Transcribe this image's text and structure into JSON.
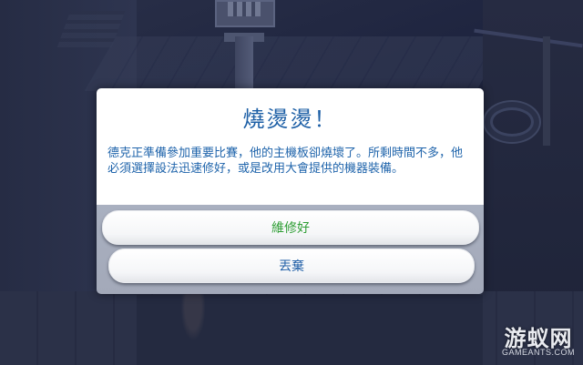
{
  "dialog": {
    "title": "燒燙燙！",
    "message": "德克正準備參加重要比賽，他的主機板卻燒壞了。所剩時間不多，他必須選擇設法迅速修好，或是改用大會提供的機器裝備。",
    "options": [
      {
        "label": "維修好",
        "color": "#2f9e35"
      },
      {
        "label": "丟棄",
        "color": "#1f5ea6"
      }
    ]
  },
  "watermark": {
    "logo": "游蚁网",
    "url": "GAMEANTS.COM"
  },
  "colors": {
    "title": "#1d5fa6",
    "message": "#1f64ab",
    "actions_bg": "#a6acbc"
  }
}
